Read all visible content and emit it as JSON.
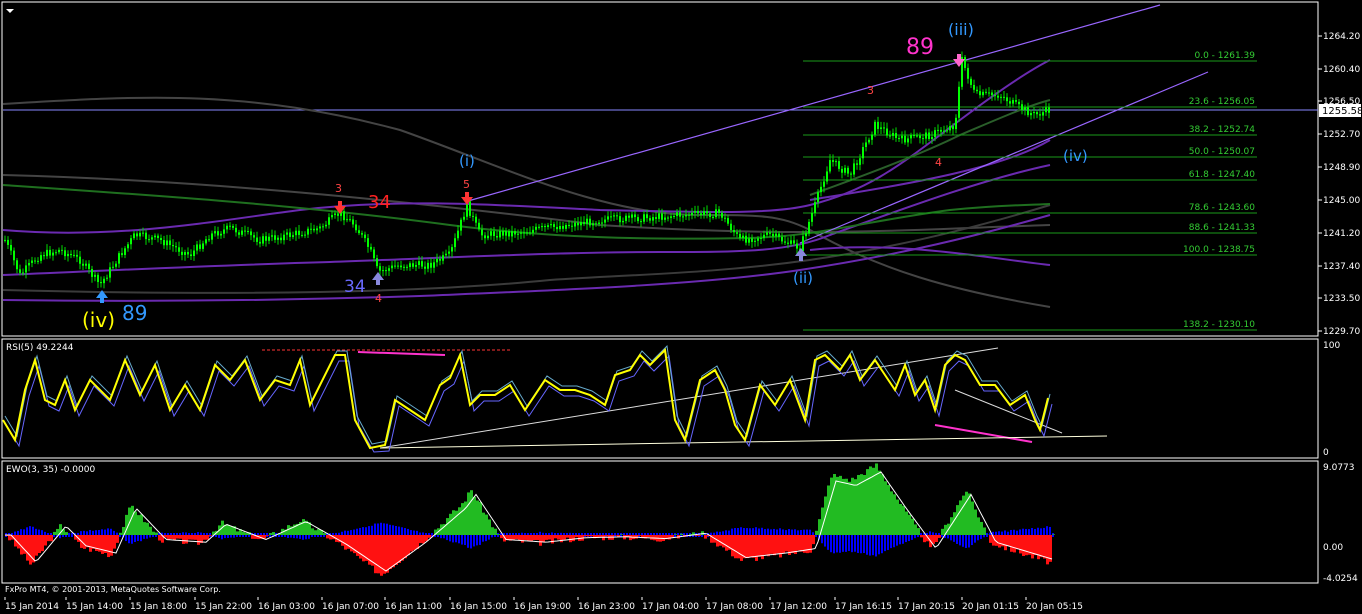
{
  "colors": {
    "background": "#000000",
    "grid": "#ffffff",
    "price_up": "#00ff00",
    "accent_magenta": "#ff00ff",
    "rsi": "#ffff00",
    "ewo_pos_bar": "#00cc00",
    "ewo_neg_bar": "#ff0000",
    "ewo_blue": "#0000ff"
  },
  "main": {
    "price_axis": [
      "1264.20",
      "1260.40",
      "1256.50",
      "1252.70",
      "1248.90",
      "1245.00",
      "1241.20",
      "1237.40",
      "1233.50",
      "1229.70"
    ],
    "current_price": "1255.58",
    "fib_levels": [
      {
        "label": "0.0 - 1261.39"
      },
      {
        "label": "23.6 - 1256.05"
      },
      {
        "label": "38.2 - 1252.74"
      },
      {
        "label": "50.0 - 1250.07"
      },
      {
        "label": "61.8 - 1247.40"
      },
      {
        "label": "78.6 - 1243.60"
      },
      {
        "label": "88.6 - 1241.33"
      },
      {
        "label": "100.0 - 1238.75"
      },
      {
        "label": "138.2 - 1230.10"
      }
    ],
    "wave_labels": {
      "iv_left": "(iv)",
      "n89_left": "89",
      "n34_bottom": "34",
      "n3_a": "3",
      "n34_red": "34",
      "n4_a": "4",
      "i_label": "(i)",
      "n5": "5",
      "ii_label": "(ii)",
      "n3_b": "3",
      "n4_b": "4",
      "n89_top": "89",
      "iii_label": "(iii)",
      "iv_right": "(iv)"
    }
  },
  "rsi": {
    "title": "RSI(5) 49.2244",
    "axis": [
      "100",
      "0"
    ]
  },
  "ewo": {
    "title": "EWO(3, 35) -0.0000",
    "axis": [
      "9.0773",
      "0.00",
      "-4.0254"
    ]
  },
  "footer_copyright": "FxPro MT4, © 2001-2013, MetaQuotes Software Corp.",
  "time_axis": [
    "15 Jan 2014",
    "15 Jan 14:00",
    "15 Jan 18:00",
    "15 Jan 22:00",
    "16 Jan 03:00",
    "16 Jan 07:00",
    "16 Jan 11:00",
    "16 Jan 15:00",
    "16 Jan 19:00",
    "16 Jan 23:00",
    "17 Jan 04:00",
    "17 Jan 08:00",
    "17 Jan 12:00",
    "17 Jan 16:15",
    "17 Jan 20:15",
    "20 Jan 01:15",
    "20 Jan 05:15"
  ]
}
